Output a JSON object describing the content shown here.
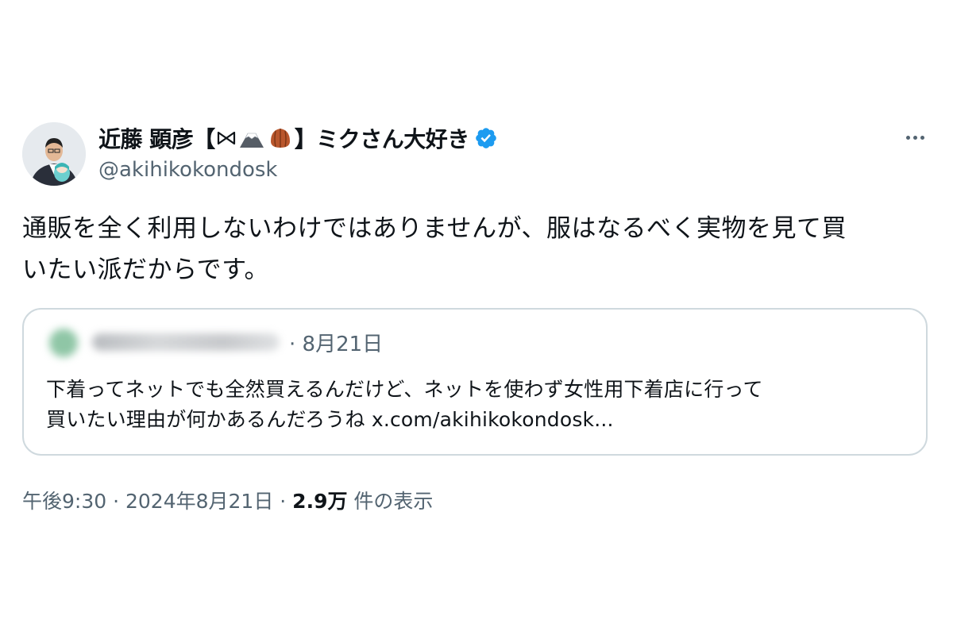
{
  "tweet": {
    "author": {
      "name_prefix": "近藤 顕彦【",
      "name_suffix": "】ミクさん大好き",
      "emoji_icons": [
        "bowtie-icon",
        "mount-fuji-icon",
        "chestnut-icon"
      ],
      "handle": "@akihikokondosk",
      "verified": true
    },
    "body_line1": "通販を全く利用しないわけではありませんが、服はなるべく実物を見て買",
    "body_line2": "いたい派だからです。",
    "quoted": {
      "date": "· 8月21日",
      "text_line1": "下着ってネットでも全然買えるんだけど、ネットを使わず女性用下着店に行って",
      "text_line2": "買いたい理由が何かあるんだろうね x.com/akihikokondosk..."
    },
    "meta": {
      "time": "午後9:30 · 2024年8月21日 · ",
      "views": "2.9万",
      "views_suffix": " 件の表示"
    }
  },
  "colors": {
    "verified_blue": "#1d9bf0",
    "secondary_text": "#536471",
    "border": "#cfd9de"
  }
}
